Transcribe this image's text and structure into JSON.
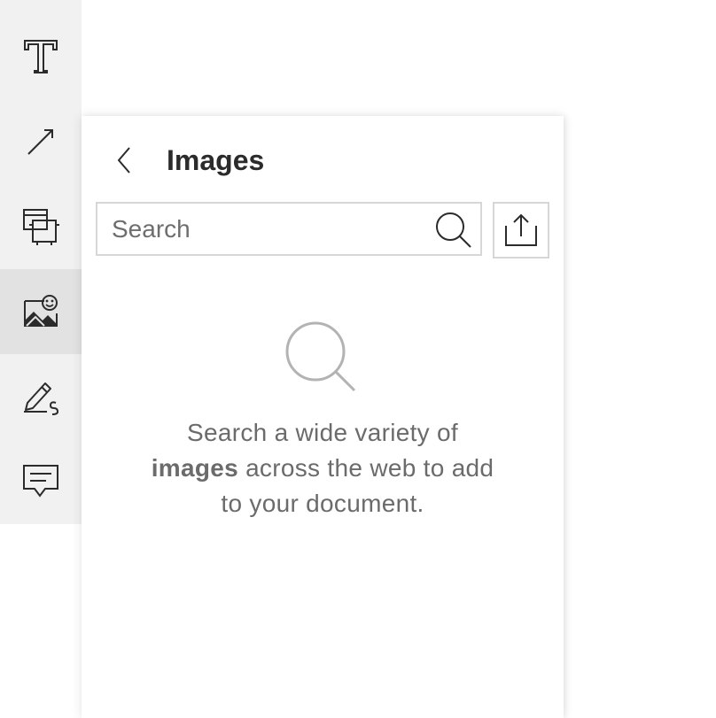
{
  "toolbar": {
    "tools": [
      {
        "name": "text-tool",
        "icon": "text-t-icon"
      },
      {
        "name": "arrow-tool",
        "icon": "arrow-icon"
      },
      {
        "name": "crop-tool",
        "icon": "crop-icon"
      },
      {
        "name": "images-tool",
        "icon": "image-sticker-icon",
        "active": true
      },
      {
        "name": "sign-tool",
        "icon": "pen-signature-icon"
      },
      {
        "name": "comment-tool",
        "icon": "comment-icon"
      }
    ]
  },
  "panel": {
    "title": "Images",
    "back_icon": "chevron-left-icon",
    "search": {
      "placeholder": "Search",
      "value": "",
      "icon": "search-icon"
    },
    "upload_icon": "upload-icon",
    "empty_state": {
      "icon": "search-large-icon",
      "line1": "Search a wide variety of",
      "bold": "images",
      "line2_rest": " across the web to add",
      "line3": "to your document."
    }
  },
  "colors": {
    "toolbar_bg": "#f1f1f1",
    "toolbar_active_bg": "#e2e2e2",
    "title": "#2b2b2b",
    "body_text": "#6b6b6b",
    "border": "#d7d7d7"
  }
}
